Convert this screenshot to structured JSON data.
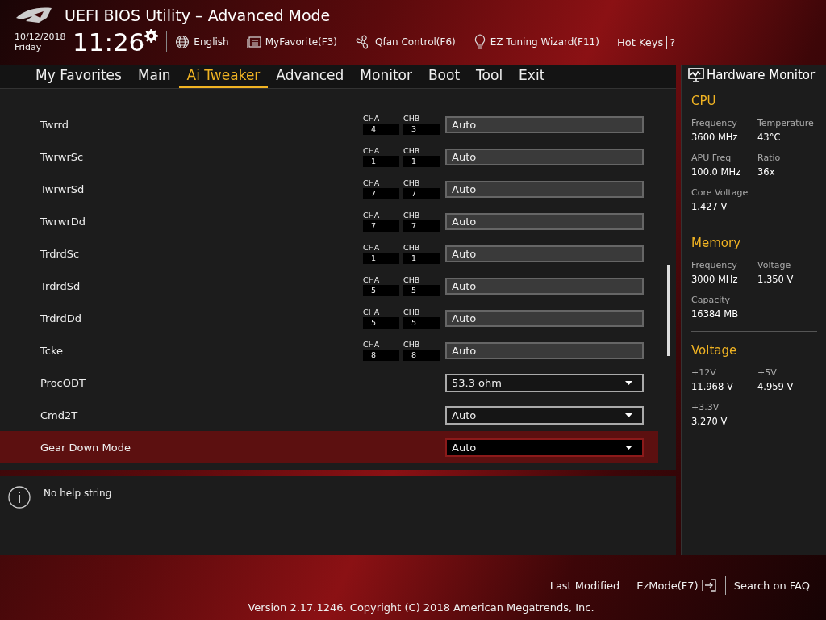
{
  "window": {
    "title": "UEFI BIOS Utility – Advanced Mode"
  },
  "header": {
    "date": "10/12/2018",
    "day": "Friday",
    "time": "11:26",
    "tools": [
      {
        "label": "English"
      },
      {
        "label": "MyFavorite(F3)"
      },
      {
        "label": "Qfan Control(F6)"
      },
      {
        "label": "EZ Tuning Wizard(F11)"
      }
    ],
    "hot_keys": {
      "label": "Hot Keys",
      "key": "?"
    }
  },
  "tabs": [
    {
      "label": "My Favorites",
      "selected": false
    },
    {
      "label": "Main",
      "selected": false
    },
    {
      "label": "Ai Tweaker",
      "selected": true
    },
    {
      "label": "Advanced",
      "selected": false
    },
    {
      "label": "Monitor",
      "selected": false
    },
    {
      "label": "Boot",
      "selected": false
    },
    {
      "label": "Tool",
      "selected": false
    },
    {
      "label": "Exit",
      "selected": false
    }
  ],
  "settings": [
    {
      "kind": "timing",
      "label": "Twrrd",
      "cha_label": "CHA",
      "cha": "4",
      "chb_label": "CHB",
      "chb": "3",
      "value": "Auto",
      "selected": false
    },
    {
      "kind": "timing",
      "label": "TwrwrSc",
      "cha_label": "CHA",
      "cha": "1",
      "chb_label": "CHB",
      "chb": "1",
      "value": "Auto",
      "selected": false
    },
    {
      "kind": "timing",
      "label": "TwrwrSd",
      "cha_label": "CHA",
      "cha": "7",
      "chb_label": "CHB",
      "chb": "7",
      "value": "Auto",
      "selected": false
    },
    {
      "kind": "timing",
      "label": "TwrwrDd",
      "cha_label": "CHA",
      "cha": "7",
      "chb_label": "CHB",
      "chb": "7",
      "value": "Auto",
      "selected": false
    },
    {
      "kind": "timing",
      "label": "TrdrdSc",
      "cha_label": "CHA",
      "cha": "1",
      "chb_label": "CHB",
      "chb": "1",
      "value": "Auto",
      "selected": false
    },
    {
      "kind": "timing",
      "label": "TrdrdSd",
      "cha_label": "CHA",
      "cha": "5",
      "chb_label": "CHB",
      "chb": "5",
      "value": "Auto",
      "selected": false
    },
    {
      "kind": "timing",
      "label": "TrdrdDd",
      "cha_label": "CHA",
      "cha": "5",
      "chb_label": "CHB",
      "chb": "5",
      "value": "Auto",
      "selected": false
    },
    {
      "kind": "timing",
      "label": "Tcke",
      "cha_label": "CHA",
      "cha": "8",
      "chb_label": "CHB",
      "chb": "8",
      "value": "Auto",
      "selected": false
    },
    {
      "kind": "dropdown",
      "label": "ProcODT",
      "value": "53.3 ohm",
      "selected": false
    },
    {
      "kind": "dropdown",
      "label": "Cmd2T",
      "value": "Auto",
      "selected": false
    },
    {
      "kind": "dropdown",
      "label": "Gear Down Mode",
      "value": "Auto",
      "selected": true
    }
  ],
  "help": {
    "text": "No help string"
  },
  "monitor": {
    "title": "Hardware Monitor",
    "sections": [
      {
        "title": "CPU",
        "items": [
          {
            "label": "Frequency",
            "value": "3600 MHz"
          },
          {
            "label": "Temperature",
            "value": "43°C"
          },
          {
            "label": "APU Freq",
            "value": "100.0 MHz"
          },
          {
            "label": "Ratio",
            "value": "36x"
          },
          {
            "label": "Core Voltage",
            "value": "1.427 V"
          }
        ]
      },
      {
        "title": "Memory",
        "items": [
          {
            "label": "Frequency",
            "value": "3000 MHz"
          },
          {
            "label": "Voltage",
            "value": "1.350 V"
          },
          {
            "label": "Capacity",
            "value": "16384 MB"
          }
        ]
      },
      {
        "title": "Voltage",
        "items": [
          {
            "label": "+12V",
            "value": "11.968 V"
          },
          {
            "label": "+5V",
            "value": "4.959 V"
          },
          {
            "label": "+3.3V",
            "value": "3.270 V"
          }
        ]
      }
    ]
  },
  "footer": {
    "links": [
      "Last Modified",
      "EzMode(F7)",
      "Search on FAQ"
    ],
    "version": "Version 2.17.1246. Copyright (C) 2018 American Megatrends, Inc."
  }
}
